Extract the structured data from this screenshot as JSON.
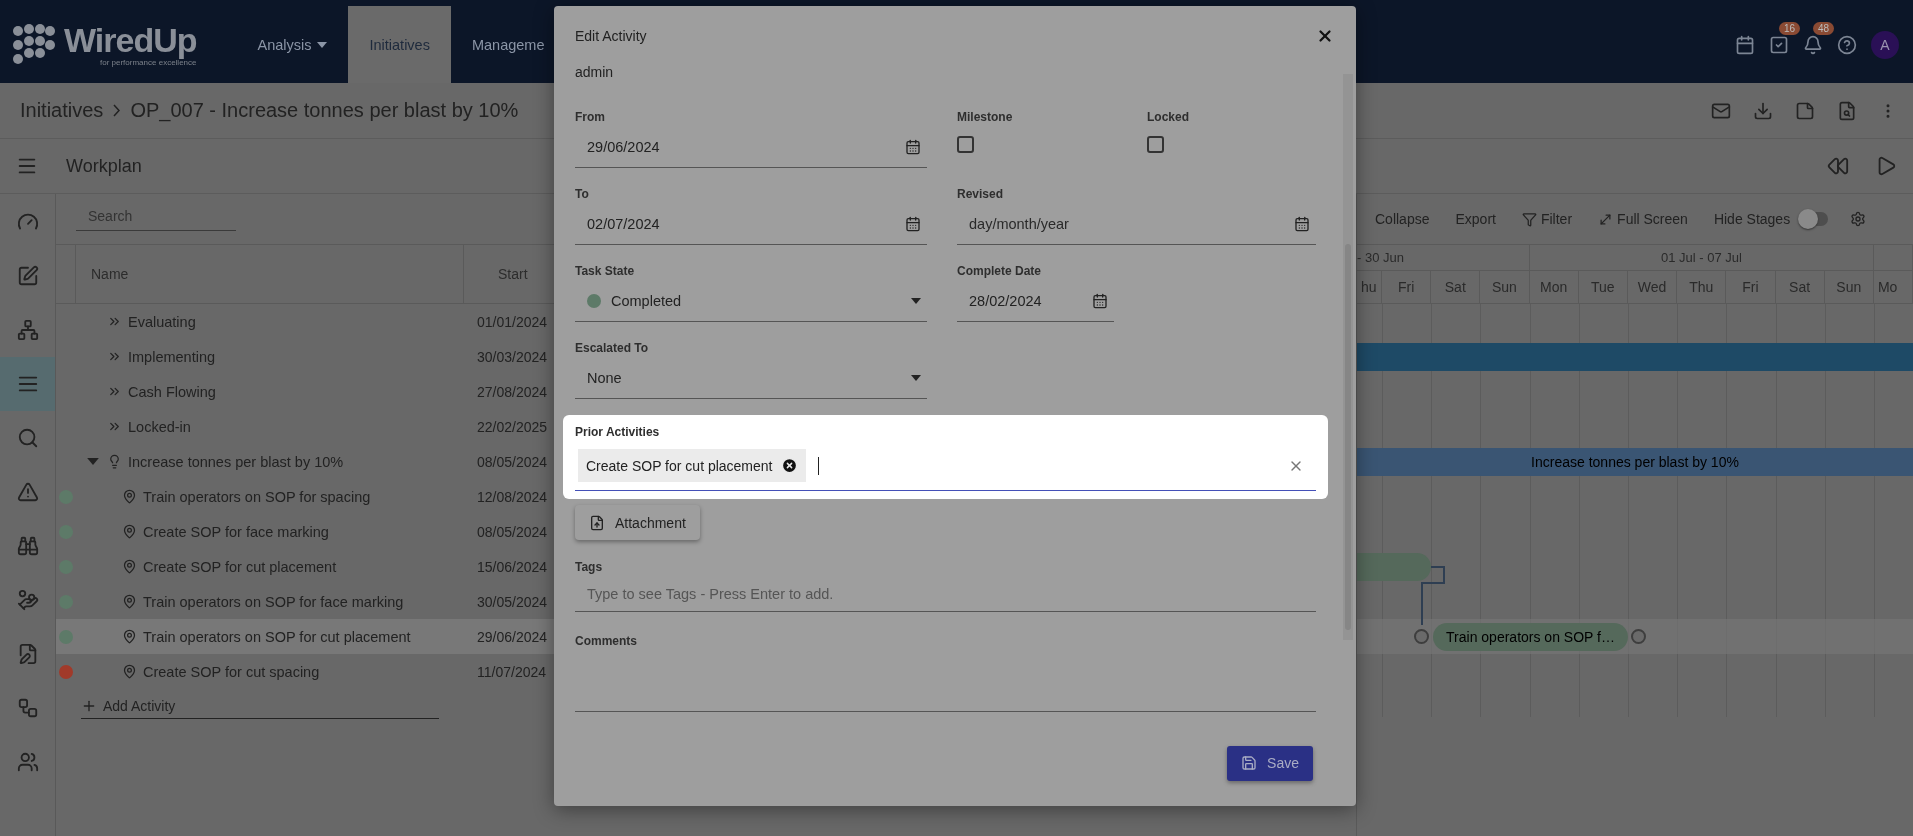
{
  "topbar": {
    "logo": {
      "name": "WiredUp",
      "tagline": "for performance excellence"
    },
    "nav": [
      {
        "label": "Analysis",
        "dropdown": true,
        "selected": false
      },
      {
        "label": "Initiatives",
        "dropdown": false,
        "selected": true
      },
      {
        "label": "Manageme",
        "dropdown": false,
        "selected": false
      }
    ],
    "tasks_badge": "16",
    "notifications_badge": "48",
    "avatar": "A"
  },
  "breadcrumb": [
    "Initiatives",
    "OP_007 - Increase tonnes per blast by 10%"
  ],
  "workplan": {
    "title": "Workplan"
  },
  "rail": [
    {
      "selected": false
    },
    {
      "selected": false
    },
    {
      "selected": false
    },
    {
      "selected": true
    },
    {
      "selected": false
    },
    {
      "selected": false
    },
    {
      "selected": false
    },
    {
      "selected": false
    },
    {
      "selected": false
    },
    {
      "selected": false
    },
    {
      "selected": false
    }
  ],
  "table": {
    "search": {
      "placeholder": "Search"
    },
    "columns": [
      "Name",
      "Start"
    ],
    "rows": [
      {
        "kind": "stage",
        "name": "Evaluating",
        "start": "01/01/2024",
        "selected": false
      },
      {
        "kind": "stage",
        "name": "Implementing",
        "start": "30/03/2024",
        "selected": false
      },
      {
        "kind": "stage",
        "name": "Cash Flowing",
        "start": "27/08/2024",
        "selected": false
      },
      {
        "kind": "stage",
        "name": "Locked-in",
        "start": "22/02/2025",
        "selected": false
      },
      {
        "kind": "initiative",
        "name": "Increase tonnes per blast by 10%",
        "start": "08/05/2024",
        "selected": false,
        "expanded": true,
        "children": [
          {
            "kind": "task",
            "name": "Train operators on SOP for spacing",
            "start": "12/08/2024",
            "color": "#5d7a68",
            "selected": false
          },
          {
            "kind": "task",
            "name": "Create SOP for face marking",
            "start": "08/05/2024",
            "color": "#5d7a68",
            "selected": false
          },
          {
            "kind": "task",
            "name": "Create SOP for cut placement",
            "start": "15/06/2024",
            "color": "#5d7a68",
            "selected": false
          },
          {
            "kind": "task",
            "name": "Train operators on SOP for face marking",
            "start": "30/05/2024",
            "color": "#5d7a68",
            "selected": false
          },
          {
            "kind": "task",
            "name": "Train operators on SOP for cut placement",
            "start": "29/06/2024",
            "color": "#5d7a68",
            "selected": true
          },
          {
            "kind": "task",
            "name": "Create SOP for cut spacing",
            "start": "11/07/2024",
            "color": "#a13a2a",
            "selected": false
          }
        ]
      }
    ],
    "add_label": "Add Activity"
  },
  "gantt": {
    "toolbar": [
      "Collapse",
      "Export",
      "Filter",
      "Full Screen"
    ],
    "hide_stages": {
      "label": "Hide Stages",
      "on": false
    },
    "weeks": [
      "- 30 Jun",
      "01 Jul - 07 Jul"
    ],
    "days": [
      "hu",
      "Fri",
      "Sat",
      "Sun",
      "Mon",
      "Tue",
      "Wed",
      "Thu",
      "Fri",
      "Sat",
      "Sun",
      "Mo"
    ],
    "bars": [
      {
        "kind": "stage"
      },
      {
        "kind": "initiative",
        "label": "Increase tonnes per blast by 10%"
      },
      {
        "kind": "task"
      },
      {
        "kind": "task",
        "label": "Train operators on SOP f…"
      }
    ]
  },
  "dialog": {
    "title": "Edit Activity",
    "owner": "admin",
    "fields": [
      {
        "kind": "date",
        "label": "From",
        "value": "29/06/2024"
      },
      {
        "kind": "checkbox",
        "label": "Milestone",
        "checked": false
      },
      {
        "kind": "checkbox",
        "label": "Locked",
        "checked": false
      },
      {
        "kind": "date",
        "label": "To",
        "value": "02/07/2024"
      },
      {
        "kind": "date",
        "label": "Revised",
        "placeholder": "day/month/year"
      },
      {
        "kind": "select",
        "label": "Task State",
        "value": "Completed",
        "color": "#5d7a68"
      },
      {
        "kind": "date",
        "label": "Complete Date",
        "value": "28/02/2024"
      },
      {
        "kind": "select",
        "label": "Escalated To",
        "value": "None"
      }
    ],
    "prior": {
      "label": "Prior Activities",
      "chips": [
        "Create SOP for cut placement"
      ]
    },
    "attachment": "Attachment",
    "tags": {
      "label": "Tags",
      "placeholder": "Type to see Tags - Press Enter to add."
    },
    "comments": {
      "label": "Comments"
    },
    "save": "Save"
  }
}
